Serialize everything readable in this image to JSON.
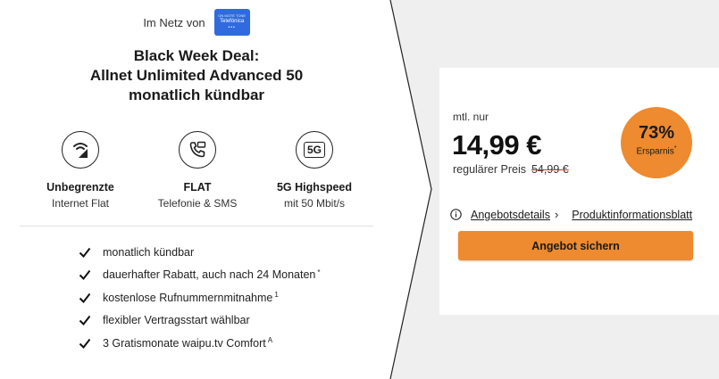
{
  "network": {
    "label": "Im Netz von",
    "provider_logo_text": "Telefónica",
    "provider_logo_small": "ON MOTE TONE"
  },
  "deal": {
    "title_line1": "Black Week Deal:",
    "title_line2": "Allnet Unlimited Advanced 50",
    "title_line3": "monatlich kündbar"
  },
  "features": [
    {
      "icon": "signal-icon",
      "title": "Unbegrenzte",
      "subtitle": "Internet Flat"
    },
    {
      "icon": "phone-message-icon",
      "title": "FLAT",
      "subtitle": "Telefonie & SMS",
      "icon_text": ""
    },
    {
      "icon": "5g-icon",
      "title": "5G Highspeed",
      "subtitle": "mit 50 Mbit/s",
      "icon_text": "5G"
    }
  ],
  "benefits": [
    {
      "text": "monatlich kündbar",
      "sup": ""
    },
    {
      "text": "dauerhafter Rabatt, auch nach 24 Monaten",
      "sup": "*"
    },
    {
      "text": "kostenlose Rufnummernmitnahme",
      "sup": "1"
    },
    {
      "text": "flexibler Vertragsstart wählbar",
      "sup": ""
    },
    {
      "text": "3 Gratismonate waipu.tv Comfort",
      "sup": "A"
    }
  ],
  "pricing": {
    "monthly_label": "mtl. nur",
    "price": "14,99 €",
    "regular_label": "regulärer Preis",
    "regular_price": "54,99 €",
    "savings_percent": "73%",
    "savings_label": "Ersparnis",
    "savings_sup": "*"
  },
  "links": {
    "details": "Angebotsdetails",
    "details_chevron": "›",
    "product_info": "Produktinformationsblatt"
  },
  "cta": {
    "label": "Angebot sichern"
  },
  "colors": {
    "accent": "#ee8a2f",
    "provider_blue": "#2f6bdf",
    "background": "#efefef"
  }
}
